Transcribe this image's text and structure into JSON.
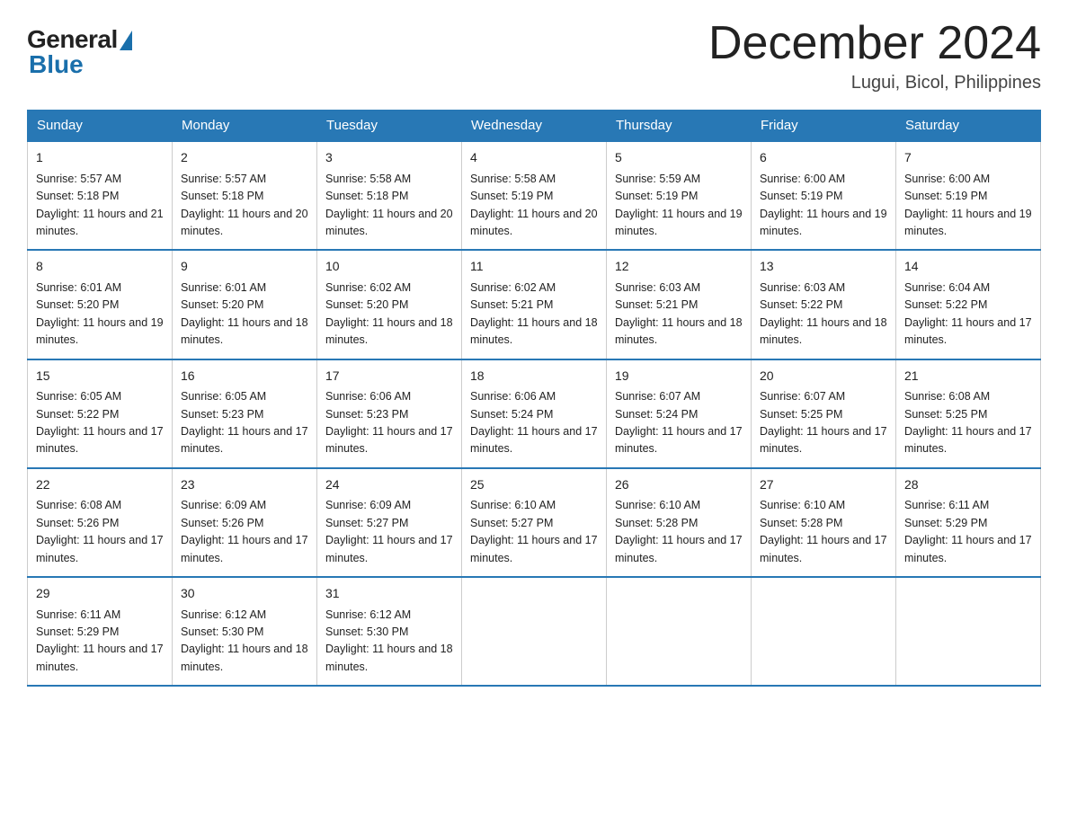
{
  "logo": {
    "general": "General",
    "blue": "Blue"
  },
  "title": {
    "month_year": "December 2024",
    "location": "Lugui, Bicol, Philippines"
  },
  "weekdays": [
    "Sunday",
    "Monday",
    "Tuesday",
    "Wednesday",
    "Thursday",
    "Friday",
    "Saturday"
  ],
  "weeks": [
    [
      {
        "day": "1",
        "sunrise": "Sunrise: 5:57 AM",
        "sunset": "Sunset: 5:18 PM",
        "daylight": "Daylight: 11 hours and 21 minutes."
      },
      {
        "day": "2",
        "sunrise": "Sunrise: 5:57 AM",
        "sunset": "Sunset: 5:18 PM",
        "daylight": "Daylight: 11 hours and 20 minutes."
      },
      {
        "day": "3",
        "sunrise": "Sunrise: 5:58 AM",
        "sunset": "Sunset: 5:18 PM",
        "daylight": "Daylight: 11 hours and 20 minutes."
      },
      {
        "day": "4",
        "sunrise": "Sunrise: 5:58 AM",
        "sunset": "Sunset: 5:19 PM",
        "daylight": "Daylight: 11 hours and 20 minutes."
      },
      {
        "day": "5",
        "sunrise": "Sunrise: 5:59 AM",
        "sunset": "Sunset: 5:19 PM",
        "daylight": "Daylight: 11 hours and 19 minutes."
      },
      {
        "day": "6",
        "sunrise": "Sunrise: 6:00 AM",
        "sunset": "Sunset: 5:19 PM",
        "daylight": "Daylight: 11 hours and 19 minutes."
      },
      {
        "day": "7",
        "sunrise": "Sunrise: 6:00 AM",
        "sunset": "Sunset: 5:19 PM",
        "daylight": "Daylight: 11 hours and 19 minutes."
      }
    ],
    [
      {
        "day": "8",
        "sunrise": "Sunrise: 6:01 AM",
        "sunset": "Sunset: 5:20 PM",
        "daylight": "Daylight: 11 hours and 19 minutes."
      },
      {
        "day": "9",
        "sunrise": "Sunrise: 6:01 AM",
        "sunset": "Sunset: 5:20 PM",
        "daylight": "Daylight: 11 hours and 18 minutes."
      },
      {
        "day": "10",
        "sunrise": "Sunrise: 6:02 AM",
        "sunset": "Sunset: 5:20 PM",
        "daylight": "Daylight: 11 hours and 18 minutes."
      },
      {
        "day": "11",
        "sunrise": "Sunrise: 6:02 AM",
        "sunset": "Sunset: 5:21 PM",
        "daylight": "Daylight: 11 hours and 18 minutes."
      },
      {
        "day": "12",
        "sunrise": "Sunrise: 6:03 AM",
        "sunset": "Sunset: 5:21 PM",
        "daylight": "Daylight: 11 hours and 18 minutes."
      },
      {
        "day": "13",
        "sunrise": "Sunrise: 6:03 AM",
        "sunset": "Sunset: 5:22 PM",
        "daylight": "Daylight: 11 hours and 18 minutes."
      },
      {
        "day": "14",
        "sunrise": "Sunrise: 6:04 AM",
        "sunset": "Sunset: 5:22 PM",
        "daylight": "Daylight: 11 hours and 17 minutes."
      }
    ],
    [
      {
        "day": "15",
        "sunrise": "Sunrise: 6:05 AM",
        "sunset": "Sunset: 5:22 PM",
        "daylight": "Daylight: 11 hours and 17 minutes."
      },
      {
        "day": "16",
        "sunrise": "Sunrise: 6:05 AM",
        "sunset": "Sunset: 5:23 PM",
        "daylight": "Daylight: 11 hours and 17 minutes."
      },
      {
        "day": "17",
        "sunrise": "Sunrise: 6:06 AM",
        "sunset": "Sunset: 5:23 PM",
        "daylight": "Daylight: 11 hours and 17 minutes."
      },
      {
        "day": "18",
        "sunrise": "Sunrise: 6:06 AM",
        "sunset": "Sunset: 5:24 PM",
        "daylight": "Daylight: 11 hours and 17 minutes."
      },
      {
        "day": "19",
        "sunrise": "Sunrise: 6:07 AM",
        "sunset": "Sunset: 5:24 PM",
        "daylight": "Daylight: 11 hours and 17 minutes."
      },
      {
        "day": "20",
        "sunrise": "Sunrise: 6:07 AM",
        "sunset": "Sunset: 5:25 PM",
        "daylight": "Daylight: 11 hours and 17 minutes."
      },
      {
        "day": "21",
        "sunrise": "Sunrise: 6:08 AM",
        "sunset": "Sunset: 5:25 PM",
        "daylight": "Daylight: 11 hours and 17 minutes."
      }
    ],
    [
      {
        "day": "22",
        "sunrise": "Sunrise: 6:08 AM",
        "sunset": "Sunset: 5:26 PM",
        "daylight": "Daylight: 11 hours and 17 minutes."
      },
      {
        "day": "23",
        "sunrise": "Sunrise: 6:09 AM",
        "sunset": "Sunset: 5:26 PM",
        "daylight": "Daylight: 11 hours and 17 minutes."
      },
      {
        "day": "24",
        "sunrise": "Sunrise: 6:09 AM",
        "sunset": "Sunset: 5:27 PM",
        "daylight": "Daylight: 11 hours and 17 minutes."
      },
      {
        "day": "25",
        "sunrise": "Sunrise: 6:10 AM",
        "sunset": "Sunset: 5:27 PM",
        "daylight": "Daylight: 11 hours and 17 minutes."
      },
      {
        "day": "26",
        "sunrise": "Sunrise: 6:10 AM",
        "sunset": "Sunset: 5:28 PM",
        "daylight": "Daylight: 11 hours and 17 minutes."
      },
      {
        "day": "27",
        "sunrise": "Sunrise: 6:10 AM",
        "sunset": "Sunset: 5:28 PM",
        "daylight": "Daylight: 11 hours and 17 minutes."
      },
      {
        "day": "28",
        "sunrise": "Sunrise: 6:11 AM",
        "sunset": "Sunset: 5:29 PM",
        "daylight": "Daylight: 11 hours and 17 minutes."
      }
    ],
    [
      {
        "day": "29",
        "sunrise": "Sunrise: 6:11 AM",
        "sunset": "Sunset: 5:29 PM",
        "daylight": "Daylight: 11 hours and 17 minutes."
      },
      {
        "day": "30",
        "sunrise": "Sunrise: 6:12 AM",
        "sunset": "Sunset: 5:30 PM",
        "daylight": "Daylight: 11 hours and 18 minutes."
      },
      {
        "day": "31",
        "sunrise": "Sunrise: 6:12 AM",
        "sunset": "Sunset: 5:30 PM",
        "daylight": "Daylight: 11 hours and 18 minutes."
      },
      null,
      null,
      null,
      null
    ]
  ]
}
